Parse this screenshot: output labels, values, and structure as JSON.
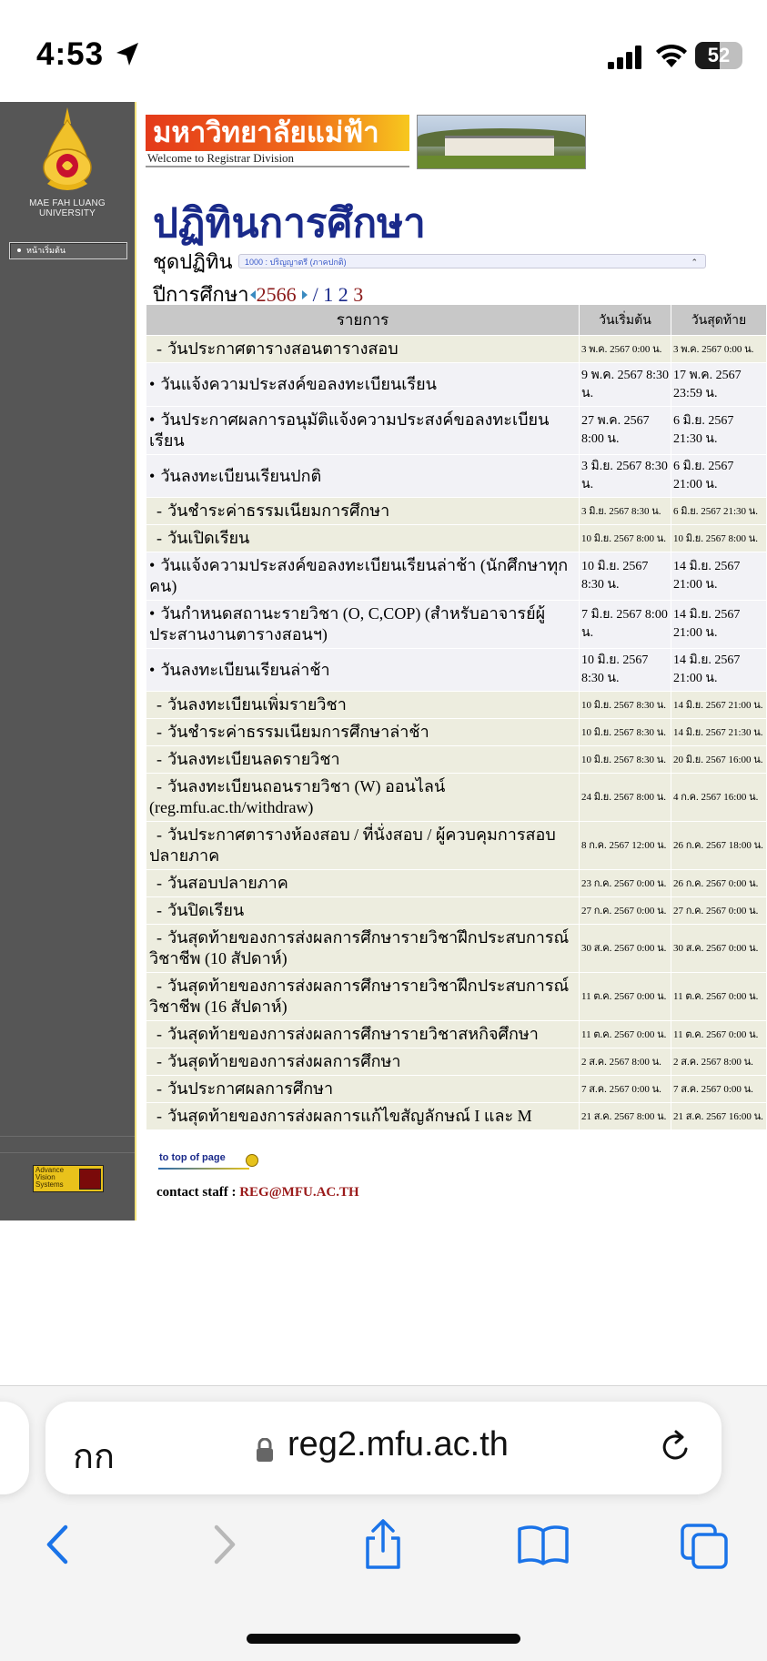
{
  "status_bar": {
    "time": "4:53",
    "battery": "52",
    "icons": [
      "location-arrow-icon",
      "signal-icon",
      "wifi-icon",
      "battery-icon"
    ]
  },
  "sidebar": {
    "university_name": "MAE FAH LUANG UNIVERSITY",
    "home_button": "หน้าเริ่มต้น",
    "badge_text": "Advance Vision Systems"
  },
  "header": {
    "banner_title": "มหาวิทยาลัยแม่ฟ้าหลวง",
    "banner_subtitle": "Welcome to Registrar Division"
  },
  "page": {
    "title": "ปฏิทินการศึกษา",
    "set_label": "ชุดปฏิทิน",
    "set_value": "1000 : ปริญญาตรี (ภาคปกติ)",
    "year_label": "ปีการศึกษา",
    "year_value": "2566",
    "pages_sep": "/",
    "pages": [
      "1",
      "2",
      "3"
    ]
  },
  "table": {
    "headers": [
      "รายการ",
      "วันเริ่มต้น",
      "วันสุดท้าย"
    ],
    "rows": [
      {
        "bullet": "-",
        "name": "วันประกาศตารางสอนตารางสอบ",
        "start": "3 พ.ค. 2567 0:00 น.",
        "end": "3 พ.ค. 2567 0:00 น.",
        "size": "small"
      },
      {
        "bullet": "•",
        "name": "วันแจ้งความประสงค์ขอลงทะเบียนเรียน",
        "start": "9 พ.ค. 2567 8:30 น.",
        "end": "17 พ.ค. 2567 23:59 น.",
        "size": "big"
      },
      {
        "bullet": "•",
        "name": "วันประกาศผลการอนุมัติแจ้งความประสงค์ขอลงทะเบียนเรียน",
        "start": "27 พ.ค. 2567 8:00 น.",
        "end": "6 มิ.ย. 2567 21:30 น.",
        "size": "big"
      },
      {
        "bullet": "•",
        "name": "วันลงทะเบียนเรียนปกติ",
        "start": "3 มิ.ย. 2567 8:30 น.",
        "end": "6 มิ.ย. 2567 21:00 น.",
        "size": "big"
      },
      {
        "bullet": "-",
        "name": "วันชำระค่าธรรมเนียมการศึกษา",
        "start": "3 มิ.ย. 2567 8:30 น.",
        "end": "6 มิ.ย. 2567 21:30 น.",
        "size": "small"
      },
      {
        "bullet": "-",
        "name": "วันเปิดเรียน",
        "start": "10 มิ.ย. 2567 8:00 น.",
        "end": "10 มิ.ย. 2567 8:00 น.",
        "size": "small"
      },
      {
        "bullet": "•",
        "name": "วันแจ้งความประสงค์ขอลงทะเบียนเรียนล่าช้า (นักศึกษาทุกคน)",
        "start": "10 มิ.ย. 2567 8:30 น.",
        "end": "14 มิ.ย. 2567 21:00 น.",
        "size": "big"
      },
      {
        "bullet": "•",
        "name": "วันกำหนดสถานะรายวิชา (O, C,COP) (สำหรับอาจารย์ผู้ประสานงานตารางสอนฯ)",
        "start": "7 มิ.ย. 2567 8:00 น.",
        "end": "14 มิ.ย. 2567 21:00 น.",
        "size": "big"
      },
      {
        "bullet": "•",
        "name": "วันลงทะเบียนเรียนล่าช้า",
        "start": "10 มิ.ย. 2567 8:30 น.",
        "end": "14 มิ.ย. 2567 21:00 น.",
        "size": "big"
      },
      {
        "bullet": "-",
        "name": "วันลงทะเบียนเพิ่มรายวิชา",
        "start": "10 มิ.ย. 2567 8:30 น.",
        "end": "14 มิ.ย. 2567 21:00 น.",
        "size": "small"
      },
      {
        "bullet": "-",
        "name": "วันชำระค่าธรรมเนียมการศึกษาล่าช้า",
        "start": "10 มิ.ย. 2567 8:30 น.",
        "end": "14 มิ.ย. 2567 21:30 น.",
        "size": "small"
      },
      {
        "bullet": "-",
        "name": "วันลงทะเบียนลดรายวิชา",
        "start": "10 มิ.ย. 2567 8:30 น.",
        "end": "20 มิ.ย. 2567 16:00 น.",
        "size": "small"
      },
      {
        "bullet": "-",
        "name": "วันลงทะเบียนถอนรายวิชา (W) ออนไลน์ (reg.mfu.ac.th/withdraw)",
        "start": "24 มิ.ย. 2567 8:00 น.",
        "end": "4 ก.ค. 2567 16:00 น.",
        "size": "small"
      },
      {
        "bullet": "-",
        "name": "วันประกาศตารางห้องสอบ / ที่นั่งสอบ / ผู้ควบคุมการสอบ ปลายภาค",
        "start": "8 ก.ค. 2567 12:00 น.",
        "end": "26 ก.ค. 2567 18:00 น.",
        "size": "small"
      },
      {
        "bullet": "-",
        "name": "วันสอบปลายภาค",
        "start": "23 ก.ค. 2567 0:00 น.",
        "end": "26 ก.ค. 2567 0:00 น.",
        "size": "small"
      },
      {
        "bullet": "-",
        "name": "วันปิดเรียน",
        "start": "27 ก.ค. 2567 0:00 น.",
        "end": "27 ก.ค. 2567 0:00 น.",
        "size": "small"
      },
      {
        "bullet": "-",
        "name": "วันสุดท้ายของการส่งผลการศึกษารายวิชาฝึกประสบการณ์วิชาชีพ (10 สัปดาห์)",
        "start": "30 ส.ค. 2567 0:00 น.",
        "end": "30 ส.ค. 2567 0:00 น.",
        "size": "small"
      },
      {
        "bullet": "-",
        "name": "วันสุดท้ายของการส่งผลการศึกษารายวิชาฝึกประสบการณ์วิชาชีพ (16 สัปดาห์)",
        "start": "11 ต.ค. 2567 0:00 น.",
        "end": "11 ต.ค. 2567 0:00 น.",
        "size": "small"
      },
      {
        "bullet": "-",
        "name": "วันสุดท้ายของการส่งผลการศึกษารายวิชาสหกิจศึกษา",
        "start": "11 ต.ค. 2567 0:00 น.",
        "end": "11 ต.ค. 2567 0:00 น.",
        "size": "small"
      },
      {
        "bullet": "-",
        "name": "วันสุดท้ายของการส่งผลการศึกษา",
        "start": "2 ส.ค. 2567 8:00 น.",
        "end": "2 ส.ค. 2567 8:00 น.",
        "size": "small"
      },
      {
        "bullet": "-",
        "name": "วันประกาศผลการศึกษา",
        "start": "7 ส.ค. 2567 0:00 น.",
        "end": "7 ส.ค. 2567 0:00 น.",
        "size": "small"
      },
      {
        "bullet": "-",
        "name": "วันสุดท้ายของการส่งผลการแก้ไขสัญลักษณ์ I และ M",
        "start": "21 ส.ค. 2567 8:00 น.",
        "end": "21 ส.ค. 2567 16:00 น.",
        "size": "small"
      }
    ]
  },
  "footer": {
    "to_top": "to top of page",
    "contact_label": "contact staff :",
    "contact_email": "REG@MFU.AC.TH"
  },
  "browser": {
    "text_size_label": "กก",
    "url": "reg2.mfu.ac.th",
    "icons": [
      "lock-icon",
      "reload-icon",
      "back-icon",
      "forward-icon",
      "share-icon",
      "bookmarks-icon",
      "tabs-icon"
    ]
  }
}
